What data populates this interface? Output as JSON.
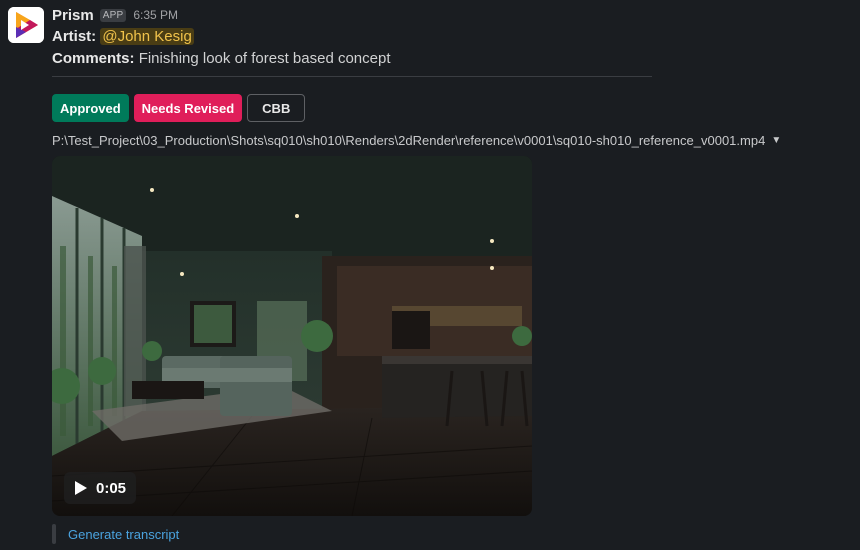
{
  "app": {
    "name": "Prism",
    "badge": "APP",
    "timestamp": "6:35 PM"
  },
  "message": {
    "artist_label": "Artist:",
    "artist_mention": "@John Kesig",
    "comments_label": "Comments:",
    "comments_text": "Finishing look of forest based concept"
  },
  "buttons": {
    "approved": "Approved",
    "needs_revised": "Needs Revised",
    "cbb": "CBB"
  },
  "attachment": {
    "path": "P:\\Test_Project\\03_Production\\Shots\\sq010\\sh010\\Renders\\2dRender\\reference\\v0001\\sq010-sh010_reference_v0001.mp4",
    "duration": "0:05"
  },
  "transcript_link": "Generate transcript",
  "colors": {
    "approved": "#007a5a",
    "needs_revised": "#e01e5a",
    "mention": "#f0c24b",
    "link": "#4aa3df"
  }
}
